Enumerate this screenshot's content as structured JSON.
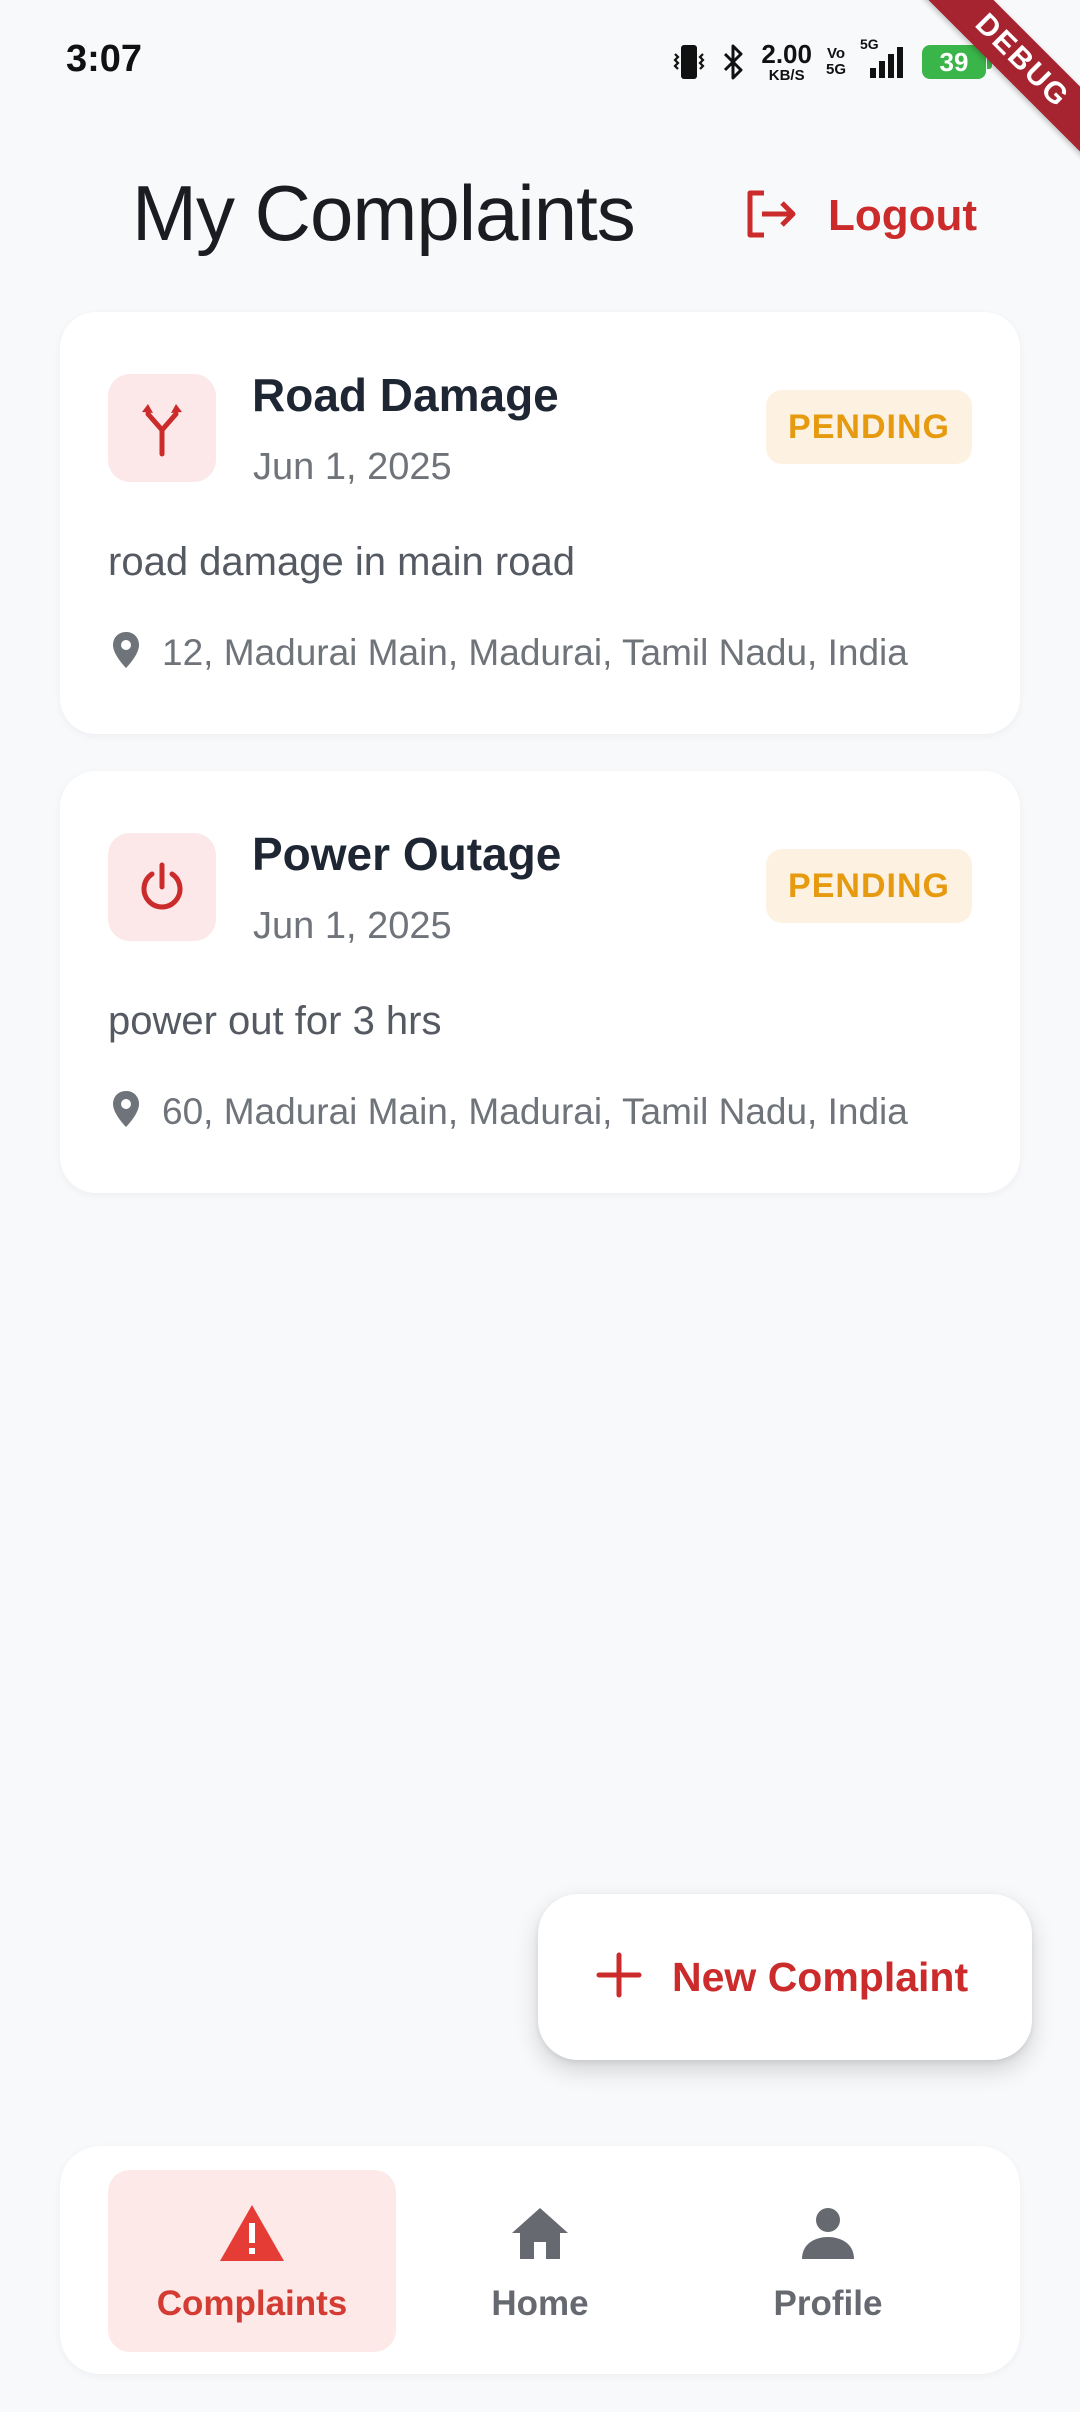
{
  "status_bar": {
    "time": "3:07",
    "net_speed_value": "2.00",
    "net_speed_unit": "KB/S",
    "volte_top": "Vo",
    "volte_bottom": "5G",
    "network_label": "5G",
    "battery_level": "39",
    "icons": [
      "vibrate-icon",
      "bluetooth-icon",
      "signal-icon",
      "battery-icon",
      "charging-icon"
    ]
  },
  "debug_banner": "DEBUG",
  "header": {
    "title": "My Complaints",
    "logout_label": "Logout",
    "logout_icon": "logout-icon"
  },
  "complaints": [
    {
      "title": "Road Damage",
      "date": "Jun 1, 2025",
      "status": "PENDING",
      "description": "road damage in main road",
      "address": "12, Madurai Main, Madurai, Tamil Nadu, India",
      "icon": "fork-road-icon"
    },
    {
      "title": "Power Outage",
      "date": "Jun 1, 2025",
      "status": "PENDING",
      "description": "power out for 3 hrs",
      "address": "60, Madurai Main, Madurai, Tamil Nadu, India",
      "icon": "power-icon"
    }
  ],
  "fab": {
    "label": "New Complaint",
    "icon": "plus-icon"
  },
  "bottom_nav": {
    "items": [
      {
        "label": "Complaints",
        "icon": "warning-icon",
        "active": true
      },
      {
        "label": "Home",
        "icon": "home-icon",
        "active": false
      },
      {
        "label": "Profile",
        "icon": "person-icon",
        "active": false
      }
    ]
  },
  "colors": {
    "accent": "#cc2b2b",
    "background": "#f8f9fb",
    "card": "#ffffff",
    "icon_bg": "#fce8e8",
    "pending_bg": "#fdf2e2",
    "pending_text": "#e69a10",
    "nav_active_bg": "#fde9e8"
  }
}
